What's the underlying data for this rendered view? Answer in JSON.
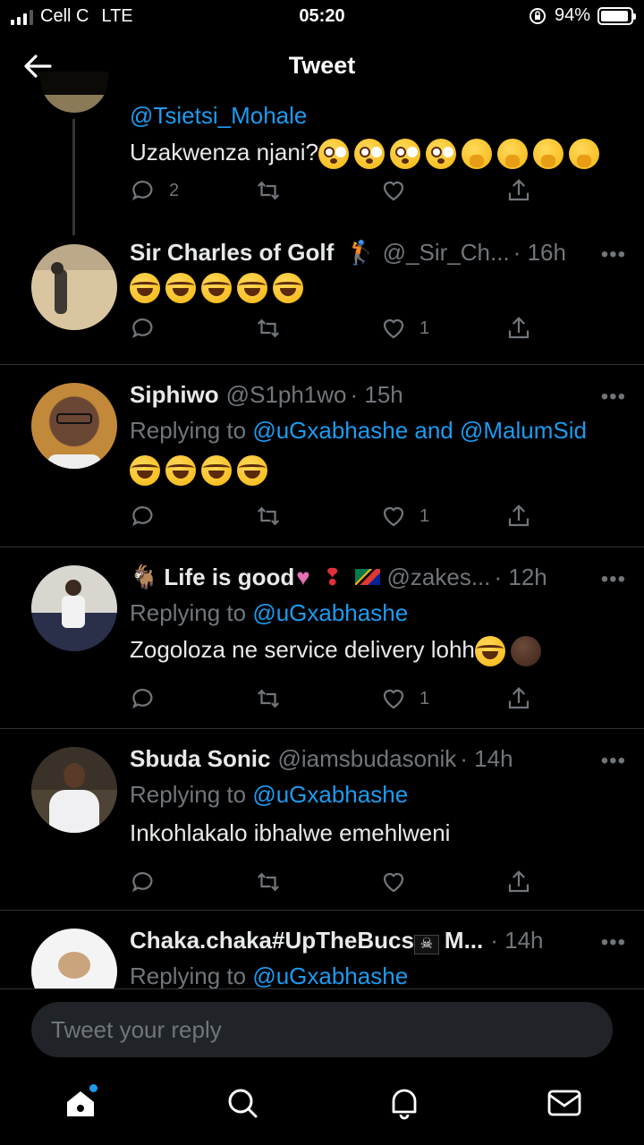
{
  "status_bar": {
    "carrier": "Cell C",
    "network": "LTE",
    "time": "05:20",
    "battery": "94%",
    "battery_level": 0.94
  },
  "header": {
    "title": "Tweet",
    "back_icon": "arrow-left-icon"
  },
  "top_reply": {
    "mention": "@Tsietsi_Mohale",
    "text": "Uzakwenza njani?",
    "emojis": [
      "flushed-face",
      "flushed-face",
      "flushed-face",
      "flushed-face",
      "face-with-hand-over-mouth",
      "face-with-hand-over-mouth",
      "face-with-hand-over-mouth",
      "face-with-hand-over-mouth"
    ],
    "reply_count": "2"
  },
  "tweets": [
    {
      "name": "Sir Charles of Golf",
      "name_emoji": "golfer",
      "handle": "@_Sir_Ch...",
      "time": "· 16h",
      "replying_to": "",
      "text": "",
      "emojis": [
        "tears-of-joy",
        "tears-of-joy",
        "tears-of-joy",
        "tears-of-joy",
        "tears-of-joy"
      ],
      "reply_count": "",
      "retweet_count": "",
      "like_count": "1"
    },
    {
      "name": "Siphiwo",
      "handle": "@S1ph1wo",
      "time": "· 15h",
      "replying_prefix": "Replying to ",
      "replying_to": "@uGxabhashe and @MalumSid",
      "text": "",
      "emojis": [
        "tears-of-joy",
        "tears-of-joy",
        "tears-of-joy",
        "tears-of-joy"
      ],
      "reply_count": "",
      "retweet_count": "",
      "like_count": "1"
    },
    {
      "name": "Life is good",
      "name_emoji": "goat heart exclamation sa-flag",
      "handle": "@zakes...",
      "time": "· 12h",
      "replying_prefix": "Replying to ",
      "replying_to": "@uGxabhashe",
      "text": "Zogoloza ne service delivery lohh",
      "emojis": [
        "tears-of-joy",
        "person-facepalming"
      ],
      "reply_count": "",
      "retweet_count": "",
      "like_count": "1"
    },
    {
      "name": "Sbuda Sonic",
      "handle": "@iamsbudasonik",
      "time": "· 14h",
      "replying_prefix": "Replying to ",
      "replying_to": "@uGxabhashe",
      "text": "Inkohlakalo ibhalwe emehlweni",
      "emojis": [],
      "reply_count": "",
      "retweet_count": "",
      "like_count": ""
    },
    {
      "name": "Chaka.chaka#UpTheBucs",
      "name_emoji": "pirate-flag",
      "name_suffix": "M...",
      "handle": "",
      "time": "· 14h",
      "replying_prefix": "Replying to ",
      "replying_to": "@uGxabhashe",
      "text": "",
      "emojis": []
    }
  ],
  "reply_box": {
    "placeholder": "Tweet your reply"
  },
  "nav": [
    "home-icon",
    "search-icon",
    "notifications-icon",
    "messages-icon"
  ],
  "more_label": "•••",
  "colors": {
    "background": "#000000",
    "accent": "#1d9bf0",
    "muted": "#71767b",
    "text": "#e7e9ea",
    "divider": "#2f3336"
  }
}
